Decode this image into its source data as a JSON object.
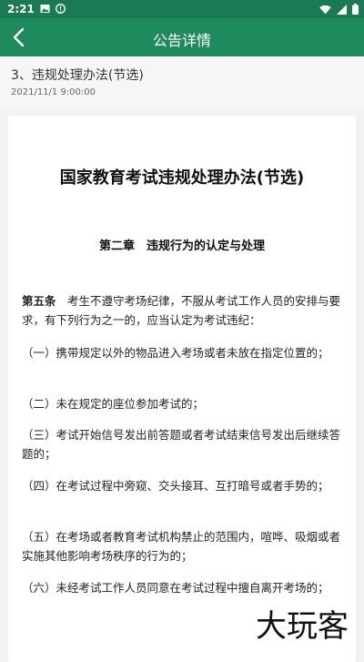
{
  "status_bar": {
    "time": "2:21"
  },
  "app_bar": {
    "title": "公告详情"
  },
  "notice": {
    "title": "3、违规处理办法(节选)",
    "date": "2021/11/1 9:00:00"
  },
  "document": {
    "title": "国家教育考试违规处理办法(节选)",
    "chapter": "第二章　违规行为的认定与处理",
    "article_label": "第五条",
    "article_text": "　考生不遵守考场纪律，不服从考试工作人员的安排与要求，有下列行为之一的，应当认定为考试违纪：",
    "items": [
      "（一）携带规定以外的物品进入考场或者未放在指定位置的；",
      "（二）未在规定的座位参加考试的；",
      "（三）考试开始信号发出前答题或者考试结束信号发出后继续答题的；",
      "（四）在考试过程中旁窥、交头接耳、互打暗号或者手势的；",
      "（五）在考场或者教育考试机构禁止的范围内，喧哗、吸烟或者实施其他影响考场秩序的行为的；",
      "（六）未经考试工作人员同意在考试过程中擅自离开考场的；"
    ]
  },
  "watermark": {
    "text": "大玩客"
  },
  "colors": {
    "status_bar": "#1a7a55",
    "app_bar": "#1f8a5e"
  }
}
